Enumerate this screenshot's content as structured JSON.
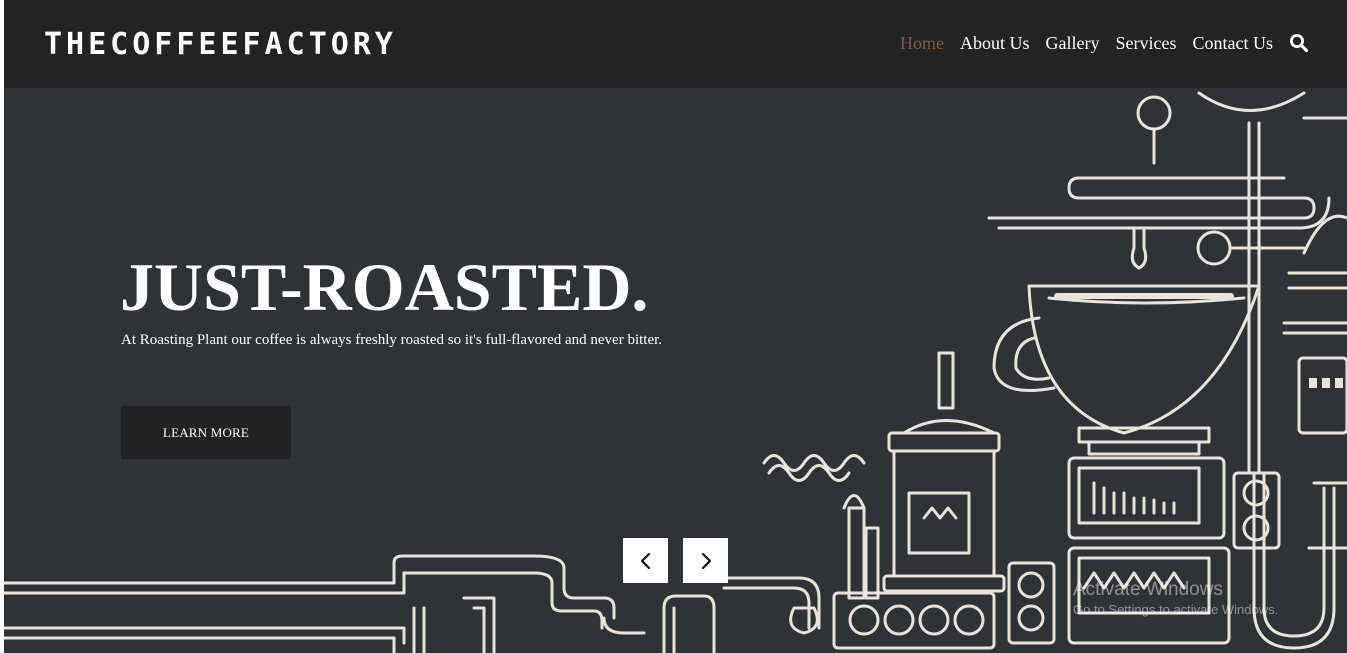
{
  "brand": {
    "logo_text": "THECOFFEEFACTORY"
  },
  "nav": {
    "items": [
      {
        "label": "Home",
        "active": true
      },
      {
        "label": "About Us"
      },
      {
        "label": "Gallery"
      },
      {
        "label": "Services"
      },
      {
        "label": "Contact Us"
      }
    ],
    "search_icon": "search-icon"
  },
  "hero": {
    "title": "JUST-ROASTED.",
    "text": "At Roasting Plant our coffee is always freshly roasted so it's full-flavored and never bitter.",
    "cta_label": "LEARN MORE"
  },
  "carousel": {
    "prev_icon": "chevron-left-icon",
    "next_icon": "chevron-right-icon"
  },
  "watermark": {
    "line1": "Activate Windows",
    "line2": "Go to Settings to activate Windows."
  },
  "colors": {
    "header_bg": "#232323",
    "hero_bg": "#303336",
    "active_nav": "#7a5a49",
    "line_art": "#e8e4dc"
  }
}
